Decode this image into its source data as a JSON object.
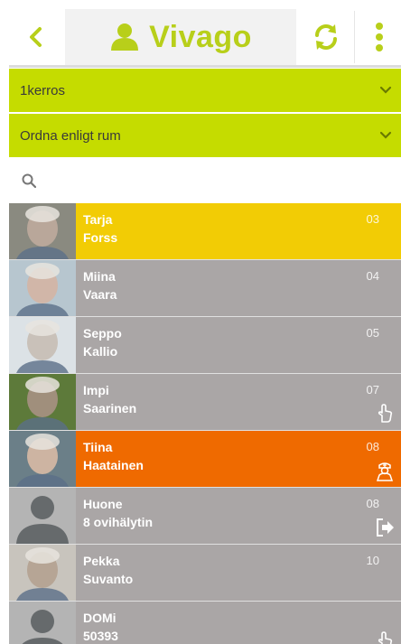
{
  "header": {
    "brand": "Vivago",
    "brand_color": "#b8cf1a"
  },
  "filters": {
    "floor": "1kerros",
    "sort": "Ordna enligt rum"
  },
  "search": {
    "icon": "search-icon"
  },
  "residents": [
    {
      "first": "Tarja",
      "last": "Forss",
      "room": "03",
      "color": "#f2cc05",
      "status_icon": ""
    },
    {
      "first": "Miina",
      "last": "Vaara",
      "room": "04",
      "color": "#aaa6a6",
      "status_icon": ""
    },
    {
      "first": "Seppo",
      "last": "Kallio",
      "room": "05",
      "color": "#aaa6a6",
      "status_icon": ""
    },
    {
      "first": "Impi",
      "last": "Saarinen",
      "room": "07",
      "color": "#aaa6a6",
      "status_icon": "hand-pointer-icon"
    },
    {
      "first": "Tiina",
      "last": "Haatainen",
      "room": "08",
      "color": "#ef6a00",
      "status_icon": "nurse-icon"
    },
    {
      "first": "Huone",
      "last": "8 ovihälytin",
      "room": "08",
      "color": "#aaa6a6",
      "status_icon": "exit-icon"
    },
    {
      "first": "Pekka",
      "last": "Suvanto",
      "room": "10",
      "color": "#aaa6a6",
      "status_icon": ""
    },
    {
      "first": "DOMi",
      "last": "50393",
      "room": "",
      "color": "#aaa6a6",
      "status_icon": "hand-pointer-icon"
    }
  ]
}
